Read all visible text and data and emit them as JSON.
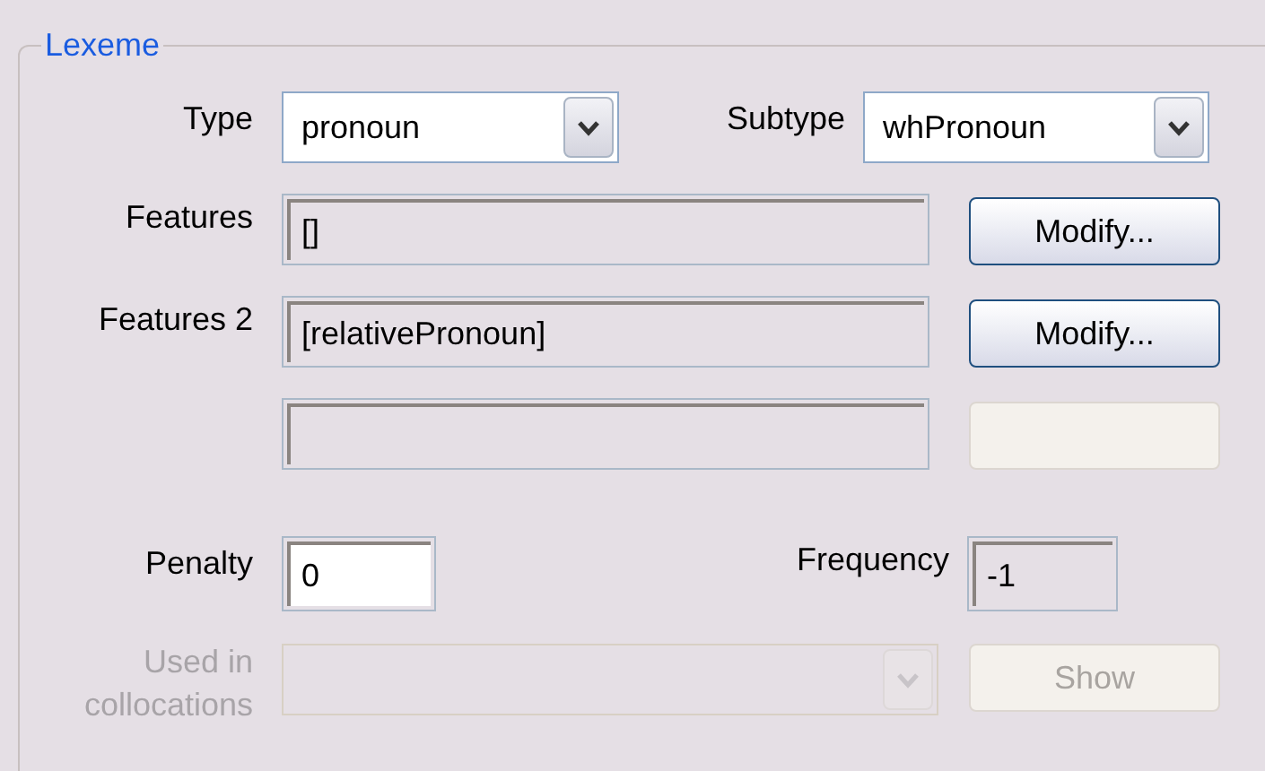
{
  "group": {
    "legend": "Lexeme"
  },
  "type_field": {
    "label": "Type",
    "value": "pronoun"
  },
  "subtype_field": {
    "label": "Subtype",
    "value": "whPronoun"
  },
  "feature_rows": [
    {
      "label": "Features",
      "value": "[]",
      "button": {
        "label": "Modify...",
        "disabled": false
      }
    },
    {
      "label": "Features 2",
      "value": "[relativePronoun]",
      "button": {
        "label": "Modify...",
        "disabled": false
      }
    },
    {
      "button": {
        "disabled": true
      }
    }
  ],
  "penalty": {
    "label": "Penalty",
    "value": "0",
    "read_only": false
  },
  "frequency": {
    "label": "Frequency",
    "value": "-1",
    "read_only": true
  },
  "collocations": {
    "label": "Used in collocations",
    "disabled": true,
    "button": {
      "label": "Show",
      "disabled": true
    }
  }
}
